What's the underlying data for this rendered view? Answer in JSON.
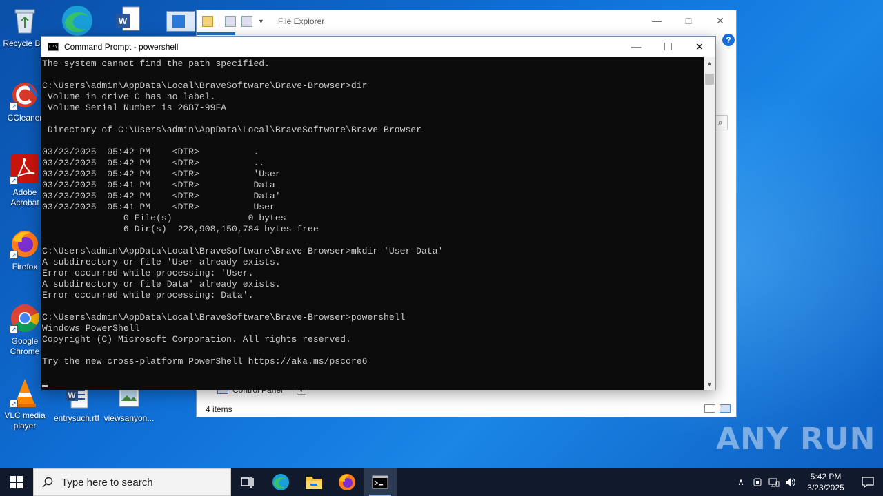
{
  "desktop": {
    "icons": [
      {
        "label": "Recycle Bin",
        "icon": "recycle-bin-icon"
      },
      {
        "label": "CCleaner",
        "icon": "ccleaner-icon"
      },
      {
        "label": "Adobe Acrobat",
        "icon": "acrobat-icon"
      },
      {
        "label": "Firefox",
        "icon": "firefox-icon"
      },
      {
        "label": "Google Chrome",
        "icon": "chrome-icon"
      },
      {
        "label": "VLC media player",
        "icon": "vlc-icon"
      },
      {
        "label": "entrysuch.rtf",
        "icon": "word-document-icon"
      },
      {
        "label": "viewsanyon...",
        "icon": "image-file-icon"
      }
    ]
  },
  "explorer": {
    "title": "File Explorer",
    "nav_item": "Control Panel",
    "status": "4 items"
  },
  "cmd": {
    "title": "Command Prompt - powershell",
    "console_lines": [
      "The system cannot find the path specified.",
      "",
      "C:\\Users\\admin\\AppData\\Local\\BraveSoftware\\Brave-Browser>dir",
      " Volume in drive C has no label.",
      " Volume Serial Number is 26B7-99FA",
      "",
      " Directory of C:\\Users\\admin\\AppData\\Local\\BraveSoftware\\Brave-Browser",
      "",
      "03/23/2025  05:42 PM    <DIR>          .",
      "03/23/2025  05:42 PM    <DIR>          ..",
      "03/23/2025  05:42 PM    <DIR>          'User",
      "03/23/2025  05:41 PM    <DIR>          Data",
      "03/23/2025  05:42 PM    <DIR>          Data'",
      "03/23/2025  05:41 PM    <DIR>          User",
      "               0 File(s)              0 bytes",
      "               6 Dir(s)  228,908,150,784 bytes free",
      "",
      "C:\\Users\\admin\\AppData\\Local\\BraveSoftware\\Brave-Browser>mkdir 'User Data'",
      "A subdirectory or file 'User already exists.",
      "Error occurred while processing: 'User.",
      "A subdirectory or file Data' already exists.",
      "Error occurred while processing: Data'.",
      "",
      "C:\\Users\\admin\\AppData\\Local\\BraveSoftware\\Brave-Browser>powershell",
      "Windows PowerShell",
      "Copyright (C) Microsoft Corporation. All rights reserved.",
      "",
      "Try the new cross-platform PowerShell https://aka.ms/pscore6"
    ]
  },
  "watermark": "ANY RUN",
  "taskbar": {
    "search_placeholder": "Type here to search",
    "apps": [
      "task-view",
      "edge",
      "file-explorer",
      "firefox",
      "command-prompt"
    ],
    "clock_time": "5:42 PM",
    "clock_date": "3/23/2025"
  },
  "colors": {
    "console_bg": "#0c0c0c",
    "console_fg": "#c8c8c8",
    "taskbar_bg": "#101a2c"
  }
}
